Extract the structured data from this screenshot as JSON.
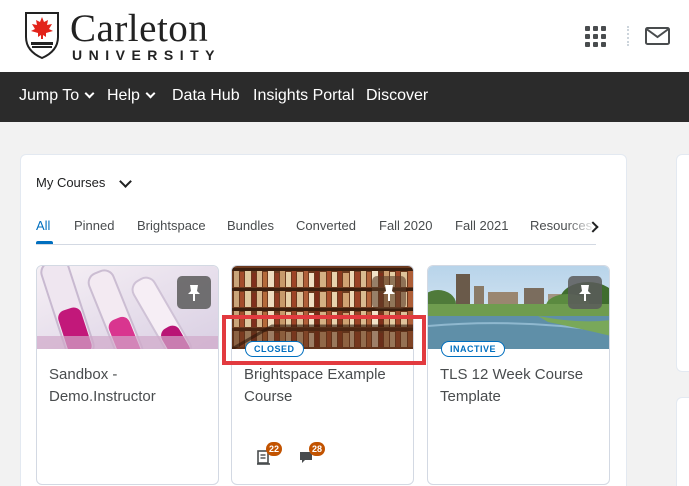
{
  "header": {
    "logo_name": "Carleton",
    "logo_sub": "UNIVERSITY",
    "apps_icon": "waffle-grid-icon",
    "mail_icon": "envelope-icon"
  },
  "nav": {
    "items": [
      {
        "label": "Jump To",
        "dropdown": true
      },
      {
        "label": "Help",
        "dropdown": true
      },
      {
        "label": "Data Hub",
        "dropdown": false
      },
      {
        "label": "Insights Portal",
        "dropdown": false
      },
      {
        "label": "Discover",
        "dropdown": false
      }
    ]
  },
  "widget": {
    "title": "My Courses",
    "tabs": [
      "All",
      "Pinned",
      "Brightspace",
      "Bundles",
      "Converted",
      "Fall 2020",
      "Fall 2021",
      "Resources"
    ],
    "active_tab": "All"
  },
  "courses": [
    {
      "title": "Sandbox - Demo.Instructor",
      "badge": "",
      "pinned": true,
      "notifications": []
    },
    {
      "title": "Brightspace Example Course",
      "badge": "CLOSED",
      "pinned": true,
      "notifications": [
        {
          "icon": "assignment-icon",
          "count": "22"
        },
        {
          "icon": "discussion-icon",
          "count": "28"
        }
      ]
    },
    {
      "title": "TLS 12 Week Course Template",
      "badge": "INACTIVE",
      "pinned": true,
      "notifications": []
    }
  ],
  "colors": {
    "nav_bg": "#2b2b2b",
    "accent": "#006fbf",
    "highlight": "#e23a3f",
    "notification": "#c25300"
  }
}
